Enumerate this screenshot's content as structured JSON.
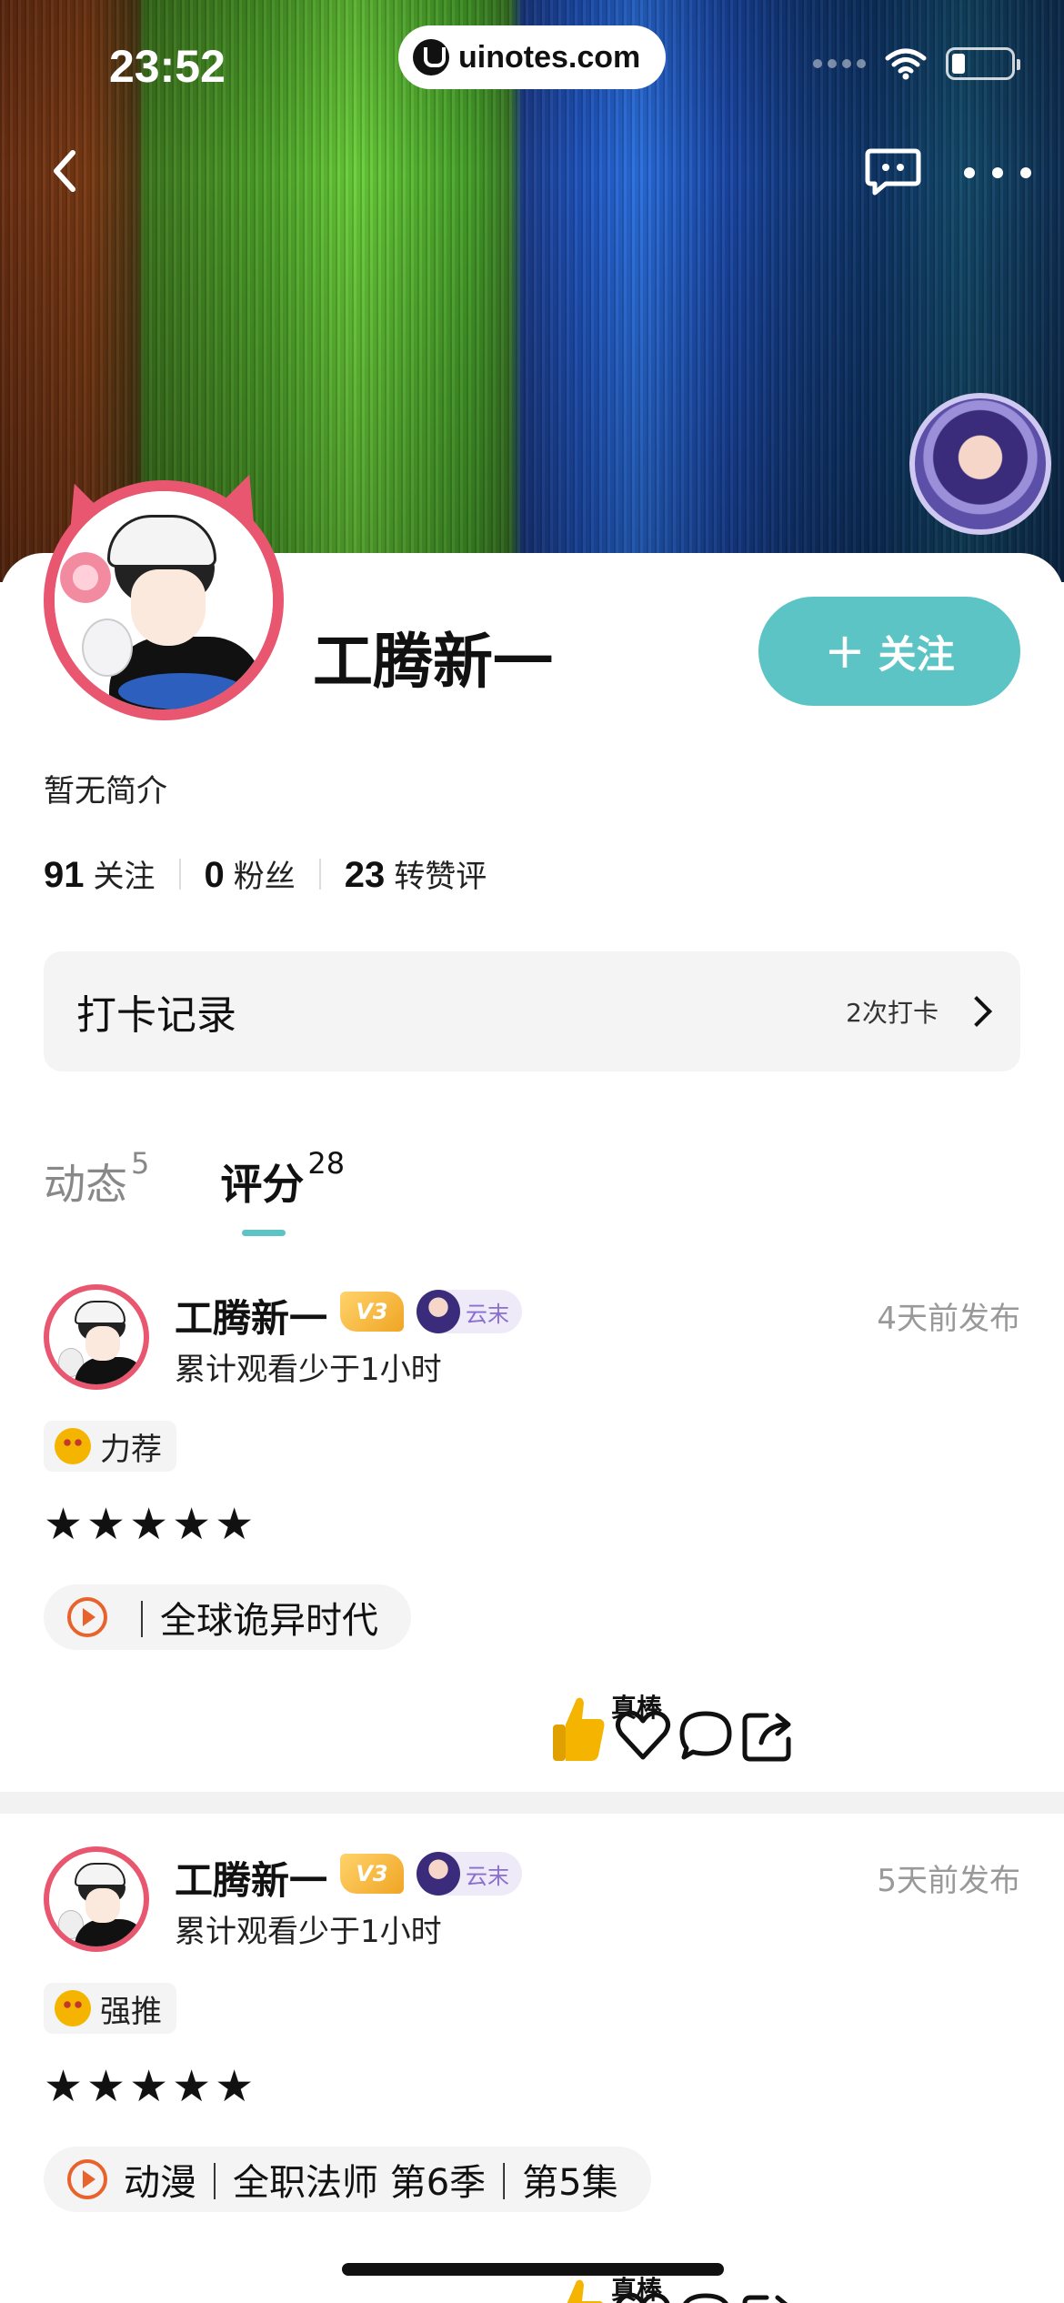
{
  "status_bar": {
    "time": "23:52",
    "url": "uinotes.com"
  },
  "profile": {
    "name": "工腾新一",
    "follow_button": "关注",
    "bio": "暂无简介",
    "stats": [
      {
        "num": "91",
        "label": "关注"
      },
      {
        "num": "0",
        "label": "粉丝"
      },
      {
        "num": "23",
        "label": "转赞评"
      }
    ],
    "checkin": {
      "title": "打卡记录",
      "count": "2次打卡"
    }
  },
  "tabs": [
    {
      "label": "动态",
      "count": "5",
      "active": false
    },
    {
      "label": "评分",
      "count": "28",
      "active": true
    }
  ],
  "posts": [
    {
      "author": "工腾新一",
      "vip": "V3",
      "badge": "云末",
      "time": "4天前发布",
      "watch": "累计观看少于1小时",
      "tag": "力荐",
      "stars": "★★★★★",
      "work": "｜全球诡异时代",
      "like_label": "真棒"
    },
    {
      "author": "工腾新一",
      "vip": "V3",
      "badge": "云末",
      "time": "5天前发布",
      "watch": "累计观看少于1小时",
      "tag": "强推",
      "stars": "★★★★★",
      "work": "动漫｜全职法师 第6季｜第5集",
      "like_label": "真棒"
    }
  ],
  "colors": {
    "accent": "#5cc4c5",
    "avatar_ring": "#e8566f",
    "play": "#e8632c"
  }
}
